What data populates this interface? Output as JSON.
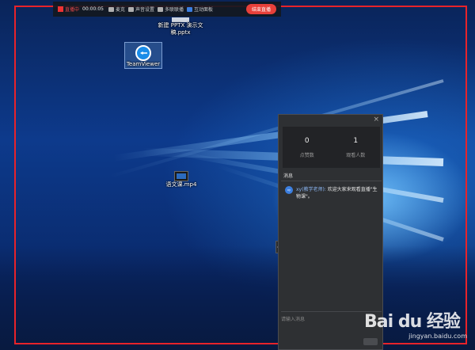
{
  "toolbar": {
    "live_label": "直播中",
    "timer": "00:00:05",
    "mic_label": "麦克",
    "sound_label": "声音设置",
    "multicam_label": "多联联播",
    "interact_label": "互动面板",
    "end_button": "结束直播"
  },
  "desktop": {
    "icons": [
      {
        "label": "新建 PPTX 演示文稿.pptx"
      },
      {
        "label": "TeamViewer"
      },
      {
        "label": "语文课.mp4"
      }
    ]
  },
  "panel": {
    "close": "×",
    "stats": [
      {
        "value": "0",
        "label": "点赞数"
      },
      {
        "value": "1",
        "label": "观看人数"
      }
    ],
    "section_title": "消息",
    "message": {
      "avatar": "xy",
      "sender": "xy(教学老师):",
      "text": "欢迎大家来观看直播\"生物课\"。"
    },
    "collapse": "<",
    "input_placeholder": "请输入消息"
  },
  "watermark": {
    "logo": "Bai du 经验",
    "url": "jingyan.baidu.com"
  },
  "colors": {
    "frame": "#e8232a",
    "end_button": "#e8403a",
    "live": "#e84848",
    "panel_bg": "#2e3033"
  }
}
